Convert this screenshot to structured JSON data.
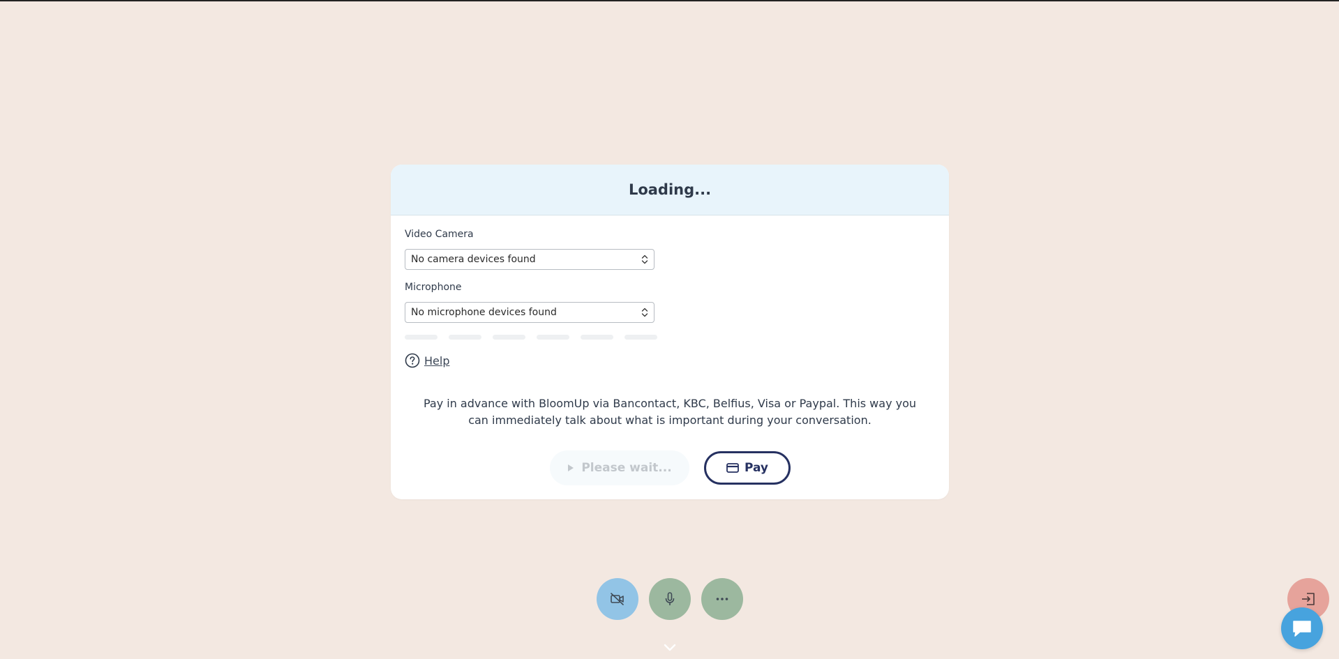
{
  "card": {
    "title": "Loading..."
  },
  "devices": {
    "camera_label": "Video Camera",
    "camera_value": "No camera devices found",
    "microphone_label": "Microphone",
    "microphone_value": "No microphone devices found"
  },
  "help": {
    "label": "Help"
  },
  "payment": {
    "text": "Pay in advance with BloomUp via Bancontact, KBC, Belfius, Visa or Paypal. This way you can immediately talk about what is important during your conversation.",
    "wait_label": "Please wait...",
    "pay_label": "Pay"
  },
  "controls": {
    "camera_icon": "camera-off-icon",
    "mic_icon": "microphone-icon",
    "more_icon": "more-dots-icon",
    "leave_icon": "exit-icon",
    "chat_icon": "chat-bubble-icon"
  },
  "colors": {
    "background": "#f3e8e1",
    "header": "#e8f4fb",
    "navy": "#263161",
    "camera_btn": "#92c4e6",
    "green_btn": "#9cb89f",
    "leave_btn": "#e6a39b",
    "chat_btn": "#47a3de"
  }
}
